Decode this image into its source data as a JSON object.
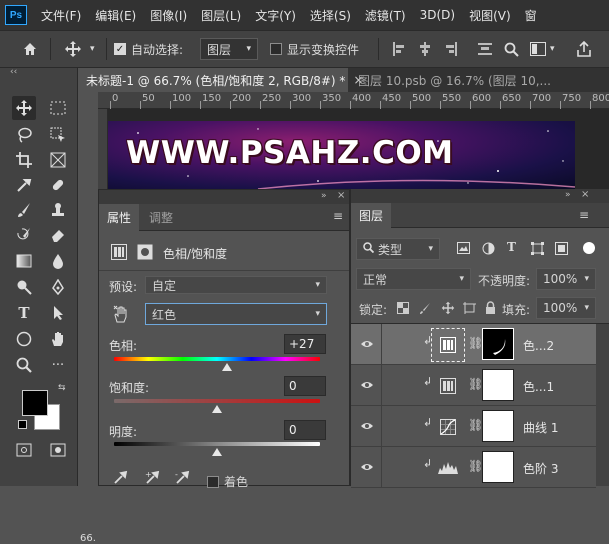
{
  "app": {
    "logo": "Ps"
  },
  "menu": [
    "文件(F)",
    "编辑(E)",
    "图像(I)",
    "图层(L)",
    "文字(Y)",
    "选择(S)",
    "滤镜(T)",
    "3D(D)",
    "视图(V)",
    "窗"
  ],
  "options": {
    "auto_select_label": "自动选择:",
    "auto_select_value": "图层",
    "show_transform_label": "显示变换控件"
  },
  "tabs": [
    {
      "label": "未标题-1 @ 66.7% (色相/饱和度 2, RGB/8#) *",
      "close": "×",
      "active": true
    },
    {
      "label": "图层 10.psb @ 16.7% (图层 10,...",
      "close": "",
      "active": false
    }
  ],
  "ruler": {
    "ticks": [
      "0",
      "50",
      "100",
      "150",
      "200",
      "250",
      "300",
      "350",
      "400",
      "450",
      "500",
      "550",
      "600",
      "650",
      "700",
      "750",
      "800"
    ]
  },
  "canvas": {
    "banner_text": "WWW.PSAHZ.COM",
    "zoom": "66."
  },
  "properties": {
    "tab_active": "属性",
    "tab_inactive": "调整",
    "title": "色相/饱和度",
    "preset_label": "预设:",
    "preset_value": "自定",
    "channel_value": "红色",
    "hue_label": "色相:",
    "hue_value": "+27",
    "sat_label": "饱和度:",
    "sat_value": "0",
    "light_label": "明度:",
    "light_value": "0",
    "colorize_label": "着色",
    "hue_level": 0.55,
    "sat_level": 0.5,
    "light_level": 0.5
  },
  "layers": {
    "tab": "图层",
    "filter_label": "类型",
    "blend_mode": "正常",
    "opacity_label": "不透明度:",
    "opacity_value": "100%",
    "lock_label": "锁定:",
    "fill_label": "填充:",
    "fill_value": "100%",
    "rows": [
      {
        "name": "色...2",
        "icon": "hue-sat-adjustment-icon",
        "selected": true
      },
      {
        "name": "色...1",
        "icon": "hue-sat-adjustment-icon",
        "selected": false
      },
      {
        "name": "曲线 1",
        "icon": "curves-adjustment-icon",
        "selected": false
      },
      {
        "name": "色阶 3",
        "icon": "levels-adjustment-icon",
        "selected": false
      }
    ]
  },
  "colors": {
    "accent": "#31a8ff",
    "selected_row": "#6e6e6e",
    "panel": "#535353",
    "dark": "#323232"
  }
}
